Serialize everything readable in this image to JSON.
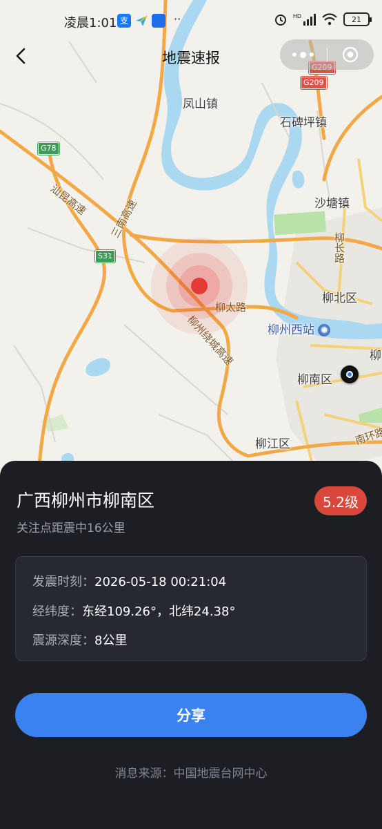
{
  "status_bar": {
    "time": "凌晨1:01",
    "battery": "21",
    "network": "HD"
  },
  "nav": {
    "title": "地震速报"
  },
  "map": {
    "places": [
      {
        "id": "fengshan",
        "label": "凤山镇"
      },
      {
        "id": "shibeiping",
        "label": "石碑坪镇"
      },
      {
        "id": "shatang",
        "label": "沙塘镇"
      },
      {
        "id": "liubei",
        "label": "柳北区"
      },
      {
        "id": "liuzhouxi",
        "label": "柳州西站"
      },
      {
        "id": "liunan",
        "label": "柳南区"
      },
      {
        "id": "liujiang",
        "label": "柳江区"
      },
      {
        "id": "liu_edge",
        "label": "柳"
      }
    ],
    "roads": [
      {
        "id": "shankun",
        "label": "汕昆高速"
      },
      {
        "id": "sannan",
        "label": "三南高速"
      },
      {
        "id": "liutai",
        "label": "柳太路"
      },
      {
        "id": "raocheng",
        "label": "柳州绕城高速"
      },
      {
        "id": "liuchang",
        "label": "柳长路"
      },
      {
        "id": "nanhuan",
        "label": "南环路"
      }
    ],
    "shields": [
      {
        "id": "g78",
        "label": "G78",
        "color": "#3f9c57"
      },
      {
        "id": "s31",
        "label": "S31",
        "color": "#3f9c57"
      },
      {
        "id": "g209a",
        "label": "G209",
        "color": "#d9534a"
      },
      {
        "id": "g209b",
        "label": "G209",
        "color": "#d9534a"
      }
    ],
    "epicenter_color": "#e53935",
    "user_location_color": "#2f7cf6"
  },
  "panel": {
    "place_name": "广西柳州市柳南区",
    "distance": "关注点距震中16公里",
    "magnitude": "5.2级",
    "details": [
      {
        "key": "发震时刻：",
        "value": "2026-05-18 00:21:04"
      },
      {
        "key": "经纬度：",
        "value": "东经109.26°，北纬24.38°"
      },
      {
        "key": "震源深度：",
        "value": "8公里"
      }
    ],
    "share_label": "分享",
    "source": "消息来源：中国地震台网中心"
  },
  "colors": {
    "panel_bg": "#1c1e24",
    "accent": "#3a82f0",
    "magnitude_badge": "#d9483b"
  }
}
